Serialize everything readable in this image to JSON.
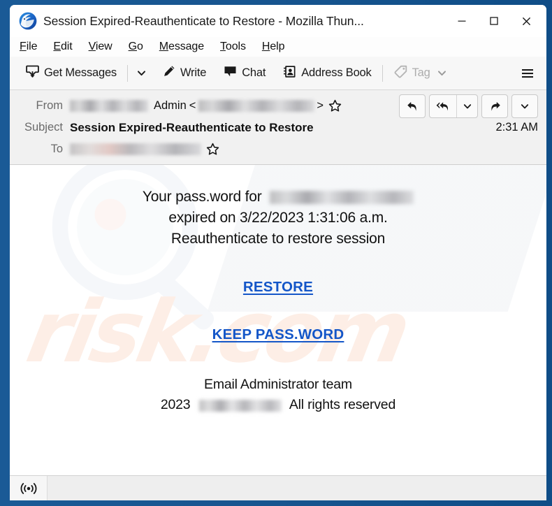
{
  "window": {
    "title": "Session Expired-Reauthenticate to Restore - Mozilla Thun...",
    "app_icon": "thunderbird-logo-icon",
    "controls": {
      "minimize": "minimize-icon",
      "maximize": "maximize-icon",
      "close": "close-icon"
    },
    "frame_color": "#15548f"
  },
  "menu_bar": {
    "items": [
      {
        "label": "File",
        "accelerator": "F"
      },
      {
        "label": "Edit",
        "accelerator": "E"
      },
      {
        "label": "View",
        "accelerator": "V"
      },
      {
        "label": "Go",
        "accelerator": "G"
      },
      {
        "label": "Message",
        "accelerator": "M"
      },
      {
        "label": "Tools",
        "accelerator": "T"
      },
      {
        "label": "Help",
        "accelerator": "H"
      }
    ]
  },
  "toolbar": {
    "get_messages_label": "Get Messages",
    "get_messages_icon": "download-inbox-icon",
    "get_messages_chevron": "chevron-down-icon",
    "write_label": "Write",
    "write_icon": "pencil-icon",
    "chat_label": "Chat",
    "chat_icon": "speech-bubble-icon",
    "address_book_label": "Address Book",
    "address_book_icon": "address-book-icon",
    "tag_label": "Tag",
    "tag_icon": "tag-icon",
    "tag_chevron": "chevron-down-icon",
    "tag_disabled": true,
    "menu_icon": "hamburger-menu-icon"
  },
  "message_header": {
    "from_label": "From",
    "from_name": "Admin",
    "from_bracket_open": "<",
    "from_bracket_close": ">",
    "from_sender_redacted": true,
    "from_address_redacted": true,
    "subject_label": "Subject",
    "subject_value": "Session Expired-Reauthenticate to Restore",
    "to_label": "To",
    "to_address_redacted": true,
    "time": "2:31 AM",
    "star_icon": "star-outline-icon",
    "actions": {
      "reply": "reply-icon",
      "reply_all": "reply-all-icon",
      "reply_all_chevron": "chevron-down-icon",
      "forward": "forward-icon",
      "more_chevron": "chevron-down-icon"
    }
  },
  "message_body": {
    "line1_prefix": "Your pass.word for",
    "line1_address_redacted": true,
    "line2": "expired on 3/22/2023 1:31:06 a.m.",
    "line3": "Reauthenticate to restore session",
    "link_restore": "RESTORE",
    "link_keep": "KEEP PASS.WORD",
    "footer_line1": "Email Administrator team",
    "footer_year": "2023",
    "footer_domain_redacted": true,
    "footer_rights": "All rights reserved",
    "link_color": "#1456c8",
    "watermark_text": "risk.com"
  },
  "status_bar": {
    "icon": "broadcast-connection-icon",
    "text": ""
  }
}
